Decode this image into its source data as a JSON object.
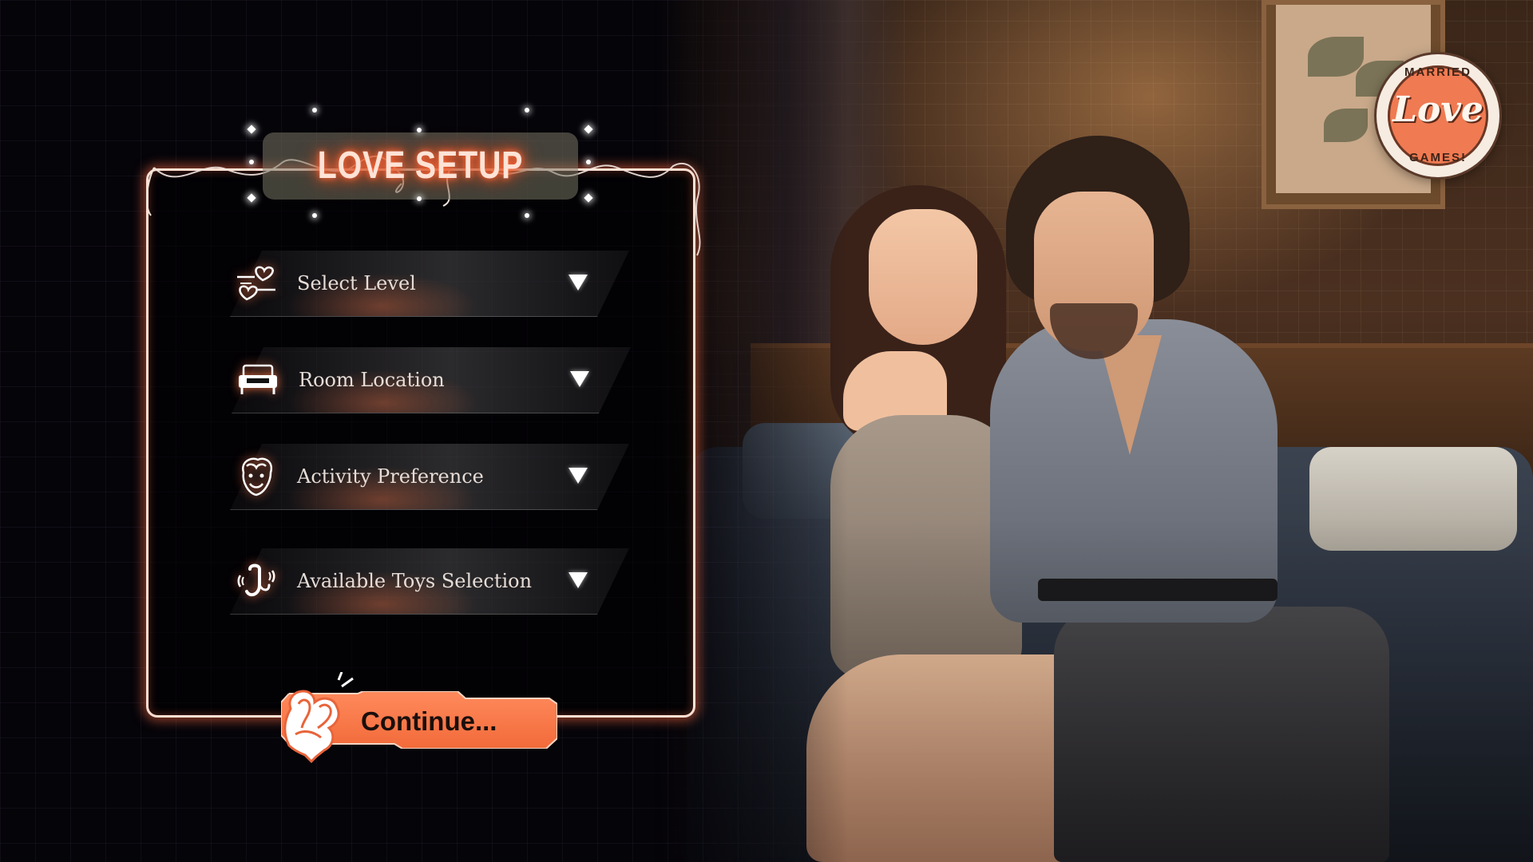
{
  "setup": {
    "title": "LOVE SETUP",
    "options": [
      {
        "label": "Select Level",
        "icon": "hearts-icon"
      },
      {
        "label": "Room Location",
        "icon": "sofa-icon"
      },
      {
        "label": "Activity Preference",
        "icon": "couple-faces-icon"
      },
      {
        "label": "Available Toys Selection",
        "icon": "toy-vibrating-icon"
      }
    ],
    "continue_label": "Continue..."
  },
  "logo": {
    "top_text": "MARRIED",
    "main_text": "Love",
    "bottom_text": "GAMES!"
  },
  "colors": {
    "accent": "#ff7a4a",
    "glow": "#ff5a2a",
    "panel_border": "#ffe0d2",
    "background": "#050409"
  }
}
